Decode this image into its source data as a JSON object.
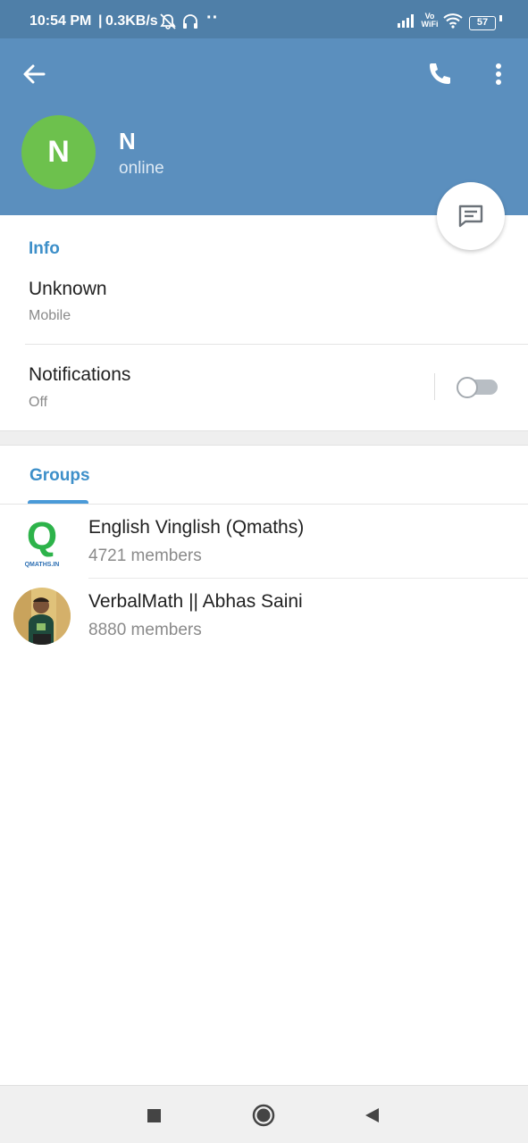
{
  "status_bar": {
    "time": "10:54 PM",
    "speed": "0.3KB/s",
    "volte": "Vo",
    "wifi_label": "WiFi",
    "battery": "57"
  },
  "header": {
    "avatar_initial": "N",
    "name": "N",
    "status": "online",
    "color": "#5b8fbe",
    "avatar_color": "#6dc14d"
  },
  "info": {
    "section_title": "Info",
    "phone_value": "Unknown",
    "phone_label": "Mobile",
    "notifications_label": "Notifications",
    "notifications_value": "Off",
    "notifications_enabled": false
  },
  "groups": {
    "tab_label": "Groups",
    "items": [
      {
        "name": "English Vinglish (Qmaths)",
        "members": "4721 members",
        "logo_letter": "Q",
        "logo_caption": "QMATHS.IN"
      },
      {
        "name": "VerbalMath || Abhas Saini",
        "members": "8880 members"
      }
    ]
  },
  "accent_color": "#3d8fc9",
  "icons": {
    "back": "arrow-left-icon",
    "call": "phone-icon",
    "menu": "more-vertical-icon",
    "message": "message-icon",
    "nav_recents": "square-icon",
    "nav_home": "circle-icon",
    "nav_back": "triangle-icon"
  }
}
